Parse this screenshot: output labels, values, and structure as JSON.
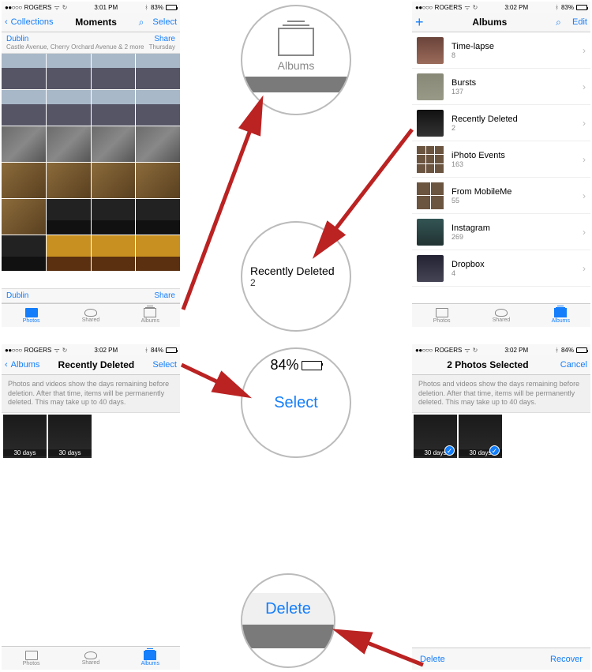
{
  "colors": {
    "accent": "#147efb",
    "arrow": "#b22222"
  },
  "carrier": "ROGERS",
  "signal_dots": "●●○○○",
  "wifi": "⦾",
  "bluetooth": "⌔",
  "loop": "↻",
  "screen1": {
    "time": "3:01 PM",
    "batt": "83%",
    "batt_fill": "83%",
    "back": "Collections",
    "title": "Moments",
    "select": "Select",
    "place": "Dublin",
    "sub": "Castle Avenue, Cherry Orchard Avenue & 2 more",
    "share": "Share",
    "day": "Thursday",
    "bottom_place": "Dublin",
    "bottom_share": "Share",
    "tabs": {
      "photos": "Photos",
      "shared": "Shared",
      "albums": "Albums"
    }
  },
  "screen2": {
    "time": "3:02 PM",
    "batt": "83%",
    "batt_fill": "83%",
    "title": "Albums",
    "edit": "Edit",
    "albums": [
      {
        "name": "Time-lapse",
        "count": "8"
      },
      {
        "name": "Bursts",
        "count": "137"
      },
      {
        "name": "Recently Deleted",
        "count": "2"
      },
      {
        "name": "iPhoto Events",
        "count": "163"
      },
      {
        "name": "From MobileMe",
        "count": "55"
      },
      {
        "name": "Instagram",
        "count": "269"
      },
      {
        "name": "Dropbox",
        "count": "4"
      }
    ],
    "tabs": {
      "photos": "Photos",
      "shared": "Shared",
      "albums": "Albums"
    }
  },
  "screen3": {
    "time": "3:02 PM",
    "batt": "84%",
    "batt_fill": "84%",
    "back": "Albums",
    "title": "Recently Deleted",
    "select": "Select",
    "note": "Photos and videos show the days remaining before deletion. After that time, items will be permanently deleted. This may take up to 40 days.",
    "thumbs": [
      {
        "label": "30 days"
      },
      {
        "label": "30 days"
      }
    ],
    "tabs": {
      "photos": "Photos",
      "shared": "Shared",
      "albums": "Albums"
    }
  },
  "screen4": {
    "time": "3:02 PM",
    "batt": "84%",
    "batt_fill": "84%",
    "title": "2 Photos Selected",
    "cancel": "Cancel",
    "note": "Photos and videos show the days remaining before deletion. After that time, items will be permanently deleted. This may take up to 40 days.",
    "thumbs": [
      {
        "label": "30 days"
      },
      {
        "label": "30 days"
      }
    ],
    "delete": "Delete",
    "recover": "Recover"
  },
  "callouts": {
    "albums_label": "Albums",
    "rd_name": "Recently Deleted",
    "rd_count": "2",
    "select_pct": "84%",
    "select_label": "Select",
    "delete_label": "Delete"
  }
}
